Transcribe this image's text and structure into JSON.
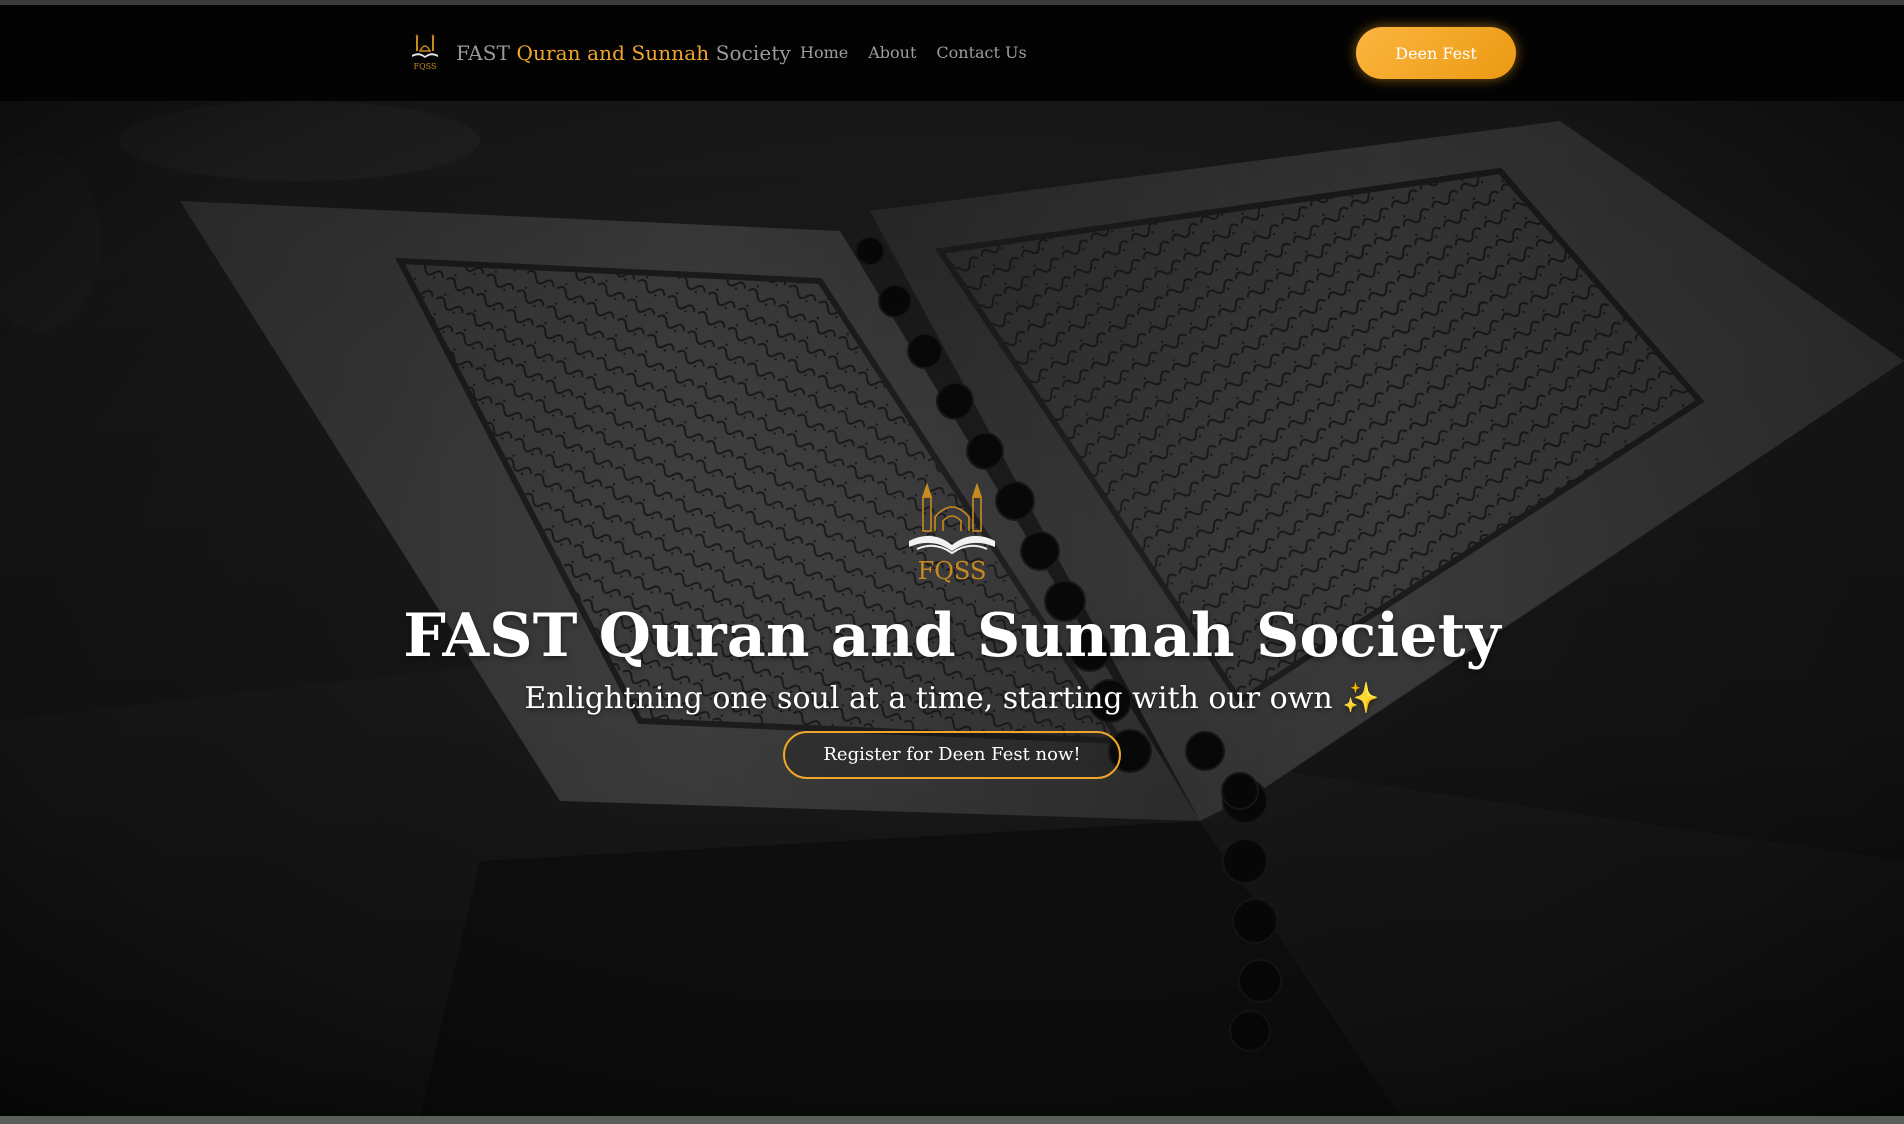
{
  "navbar": {
    "brand": {
      "prefix": "FAST",
      "accent": "Quran and Sunnah",
      "suffix": "Society",
      "logo_text": "FQSS"
    },
    "links": [
      {
        "label": "Home"
      },
      {
        "label": "About"
      },
      {
        "label": "Contact Us"
      }
    ],
    "cta_label": "Deen Fest"
  },
  "hero": {
    "logo_text": "FQSS",
    "title": "FAST Quran and Sunnah Society",
    "subtitle": "Enlightning one soul at a time, starting with our own ✨",
    "button_label": "Register for Deen Fest now!",
    "background_image": "open-quran-book-with-prayer-beads"
  },
  "colors": {
    "accent": "#f0a62a",
    "cta_gradient_start": "#fcb53f",
    "cta_gradient_end": "#eb9a12",
    "navbar_bg": "#030303",
    "nav_text": "#9d9d9d"
  }
}
